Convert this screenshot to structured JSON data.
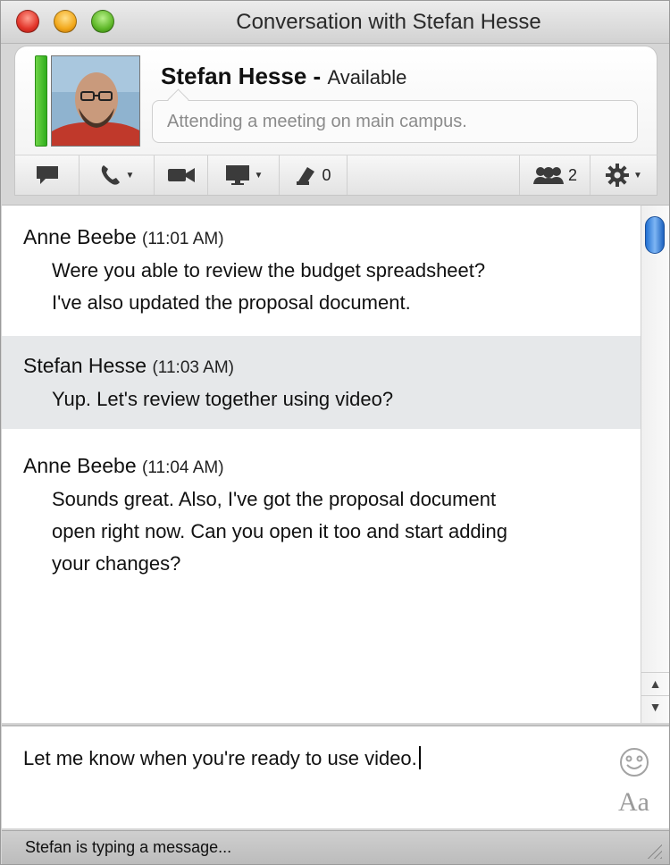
{
  "window": {
    "title": "Conversation with Stefan Hesse"
  },
  "contact": {
    "name": "Stefan Hesse",
    "separator": "-",
    "presence": "Available",
    "status_message": "Attending a meeting on main campus.",
    "presence_color": "#3cbf22"
  },
  "toolbar": {
    "buttons": [
      {
        "icon": "chat-bubble-icon"
      },
      {
        "icon": "phone-icon",
        "has_dropdown": true
      },
      {
        "icon": "video-camera-icon"
      },
      {
        "icon": "screen-share-icon",
        "has_dropdown": true
      },
      {
        "icon": "file-transfer-icon",
        "count": "0"
      },
      {
        "icon": "participants-icon",
        "count": "2"
      },
      {
        "icon": "gear-icon",
        "has_dropdown": true
      }
    ]
  },
  "messages": [
    {
      "sender": "Anne Beebe",
      "time": "(11:01 AM)",
      "lines": [
        "Were you able to review the budget spreadsheet?",
        "I've also updated the proposal document."
      ],
      "highlighted": false
    },
    {
      "sender": "Stefan Hesse",
      "time": "(11:03 AM)",
      "lines": [
        "Yup. Let's review together using video?"
      ],
      "highlighted": true
    },
    {
      "sender": "Anne Beebe",
      "time": "(11:04 AM)",
      "lines": [
        "Sounds great. Also, I've got the proposal document",
        "open right now. Can you open it too and start adding",
        "your changes?"
      ],
      "highlighted": false
    }
  ],
  "compose": {
    "value": "Let me know when you're ready to use video.",
    "font_button_label": "Aa"
  },
  "status_bar": {
    "text": "Stefan is typing a message..."
  },
  "colors": {
    "highlight_row": "#e6e8ea",
    "scroll_thumb": "#3d8ae6"
  }
}
